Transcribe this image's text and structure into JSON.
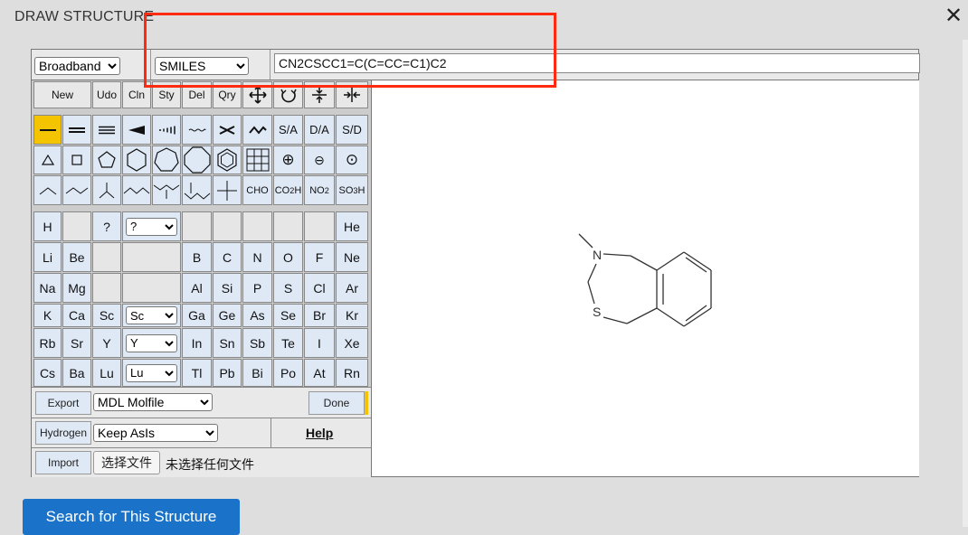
{
  "dialog": {
    "title": "DRAW STRUCTURE",
    "close_icon": "close-icon"
  },
  "topbar": {
    "mode_select": "Broadband",
    "format_select": "SMILES",
    "smiles_value": "CN2CSCC1=C(C=CC=C1)C2"
  },
  "tools": {
    "new": "New",
    "undo": "Udo",
    "clean": "Cln",
    "style": "Sty",
    "delete": "Del",
    "query": "Qry",
    "sa": "S/A",
    "da": "D/A",
    "sd": "S/D",
    "cho": "CHO",
    "co2h": "CO",
    "co2h_sub": "2",
    "co2h_tail": "H",
    "no2": "NO",
    "no2_sub": "2",
    "so3h": "SO",
    "so3h_sub": "3",
    "so3h_tail": "H"
  },
  "elements": {
    "H": "H",
    "q": "?",
    "q_select": "?",
    "He": "He",
    "Li": "Li",
    "Be": "Be",
    "B": "B",
    "C": "C",
    "N": "N",
    "O": "O",
    "F": "F",
    "Ne": "Ne",
    "Na": "Na",
    "Mg": "Mg",
    "Al": "Al",
    "Si": "Si",
    "P": "P",
    "S": "S",
    "Cl": "Cl",
    "Ar": "Ar",
    "K": "K",
    "Ca": "Ca",
    "Sc": "Sc",
    "Sc_select": "Sc",
    "Ga": "Ga",
    "Ge": "Ge",
    "As": "As",
    "Se": "Se",
    "Br": "Br",
    "Kr": "Kr",
    "Rb": "Rb",
    "Sr": "Sr",
    "Y": "Y",
    "Y_select": "Y",
    "In": "In",
    "Sn": "Sn",
    "Sb": "Sb",
    "Te": "Te",
    "I": "I",
    "Xe": "Xe",
    "Cs": "Cs",
    "Ba": "Ba",
    "Lu": "Lu",
    "Lu_select": "Lu",
    "Tl": "Tl",
    "Pb": "Pb",
    "Bi": "Bi",
    "Po": "Po",
    "At": "At",
    "Rn": "Rn"
  },
  "bottom": {
    "export": "Export",
    "export_format": "MDL Molfile",
    "done": "Done",
    "hydrogen": "Hydrogen",
    "hydrogen_option": "Keep AsIs",
    "help": "Help",
    "import": "Import",
    "choose_file": "选择文件",
    "no_file": "未选择任何文件"
  },
  "molecule": {
    "atom_n": "N",
    "atom_s": "S"
  },
  "search_button": "Search for This Structure",
  "colors": {
    "selected_tool": "#f4c400",
    "search_button": "#1a73c8",
    "highlight_box": "#ff2a12"
  }
}
